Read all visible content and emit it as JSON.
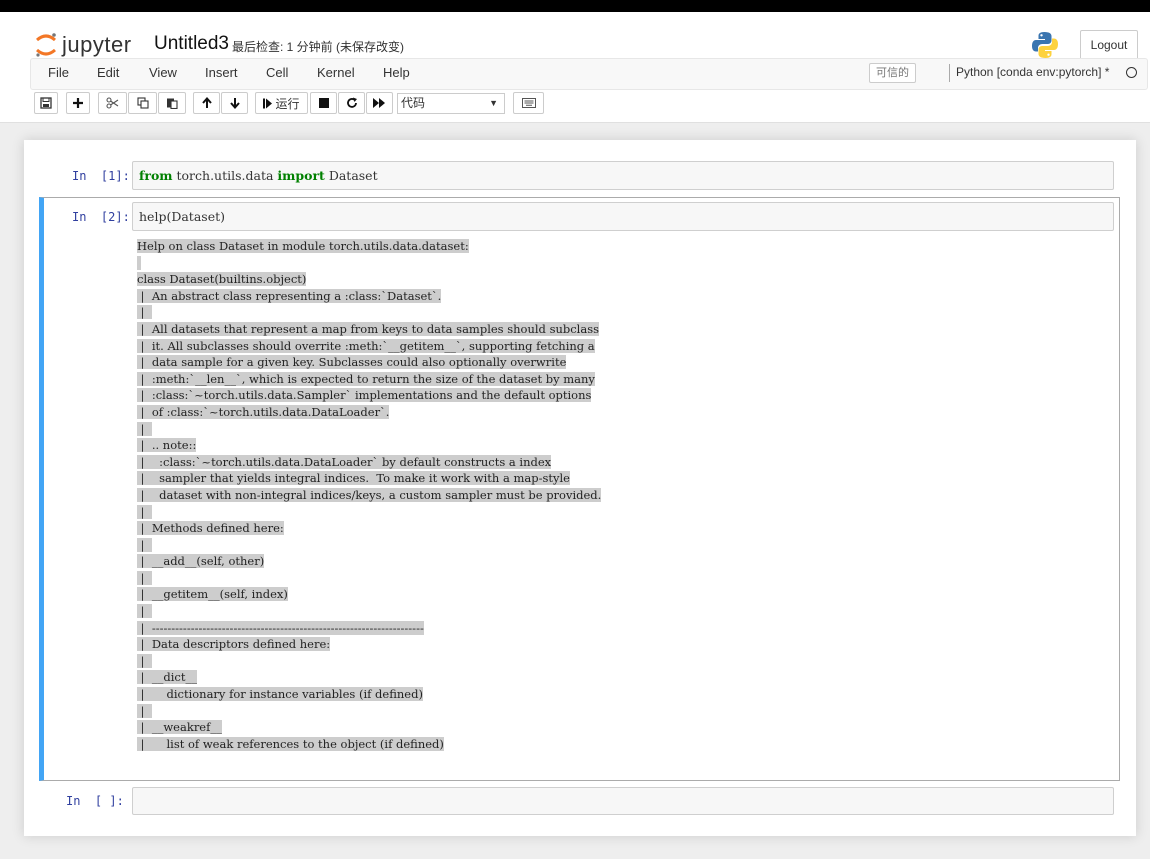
{
  "app": {
    "logo_text": "jupyter",
    "notebook_name": "Untitled3",
    "checkpoint_text": "最后检查: 1 分钟前  (未保存改变)",
    "logout_label": "Logout"
  },
  "menu": {
    "items": [
      "File",
      "Edit",
      "View",
      "Insert",
      "Cell",
      "Kernel",
      "Help"
    ],
    "trusted_label": "可信的",
    "kernel_name": "Python [conda env:pytorch] *"
  },
  "toolbar": {
    "run_label": "运行",
    "cell_type": "代码"
  },
  "cells": [
    {
      "prompt": "In  [1]:",
      "code_parts": [
        {
          "text": "from",
          "kw": true
        },
        {
          "text": " torch.utils.data ",
          "kw": false
        },
        {
          "text": "import",
          "kw": true
        },
        {
          "text": " Dataset",
          "kw": false
        }
      ]
    },
    {
      "prompt": "In  [2]:",
      "code": "help(Dataset)",
      "output_lines": [
        "Help on class Dataset in module torch.utils.data.dataset:",
        "",
        "class Dataset(builtins.object)",
        " |  An abstract class representing a :class:`Dataset`.",
        " |  ",
        " |  All datasets that represent a map from keys to data samples should subclass",
        " |  it. All subclasses should overrite :meth:`__getitem__`, supporting fetching a",
        " |  data sample for a given key. Subclasses could also optionally overwrite",
        " |  :meth:`__len__`, which is expected to return the size of the dataset by many",
        " |  :class:`~torch.utils.data.Sampler` implementations and the default options",
        " |  of :class:`~torch.utils.data.DataLoader`.",
        " |  ",
        " |  .. note::",
        " |    :class:`~torch.utils.data.DataLoader` by default constructs a index",
        " |    sampler that yields integral indices.  To make it work with a map-style",
        " |    dataset with non-integral indices/keys, a custom sampler must be provided.",
        " |  ",
        " |  Methods defined here:",
        " |  ",
        " |  __add__(self, other)",
        " |  ",
        " |  __getitem__(self, index)",
        " |  ",
        " |  ----------------------------------------------------------------------",
        " |  Data descriptors defined here:",
        " |  ",
        " |  __dict__",
        " |      dictionary for instance variables (if defined)",
        " |  ",
        " |  __weakref__",
        " |      list of weak references to the object (if defined)"
      ]
    },
    {
      "prompt": "In  [ ]:",
      "code": ""
    }
  ],
  "colors": {
    "accent": "#42a5f5",
    "prompt": "#303f9f",
    "keyword": "#008000"
  }
}
